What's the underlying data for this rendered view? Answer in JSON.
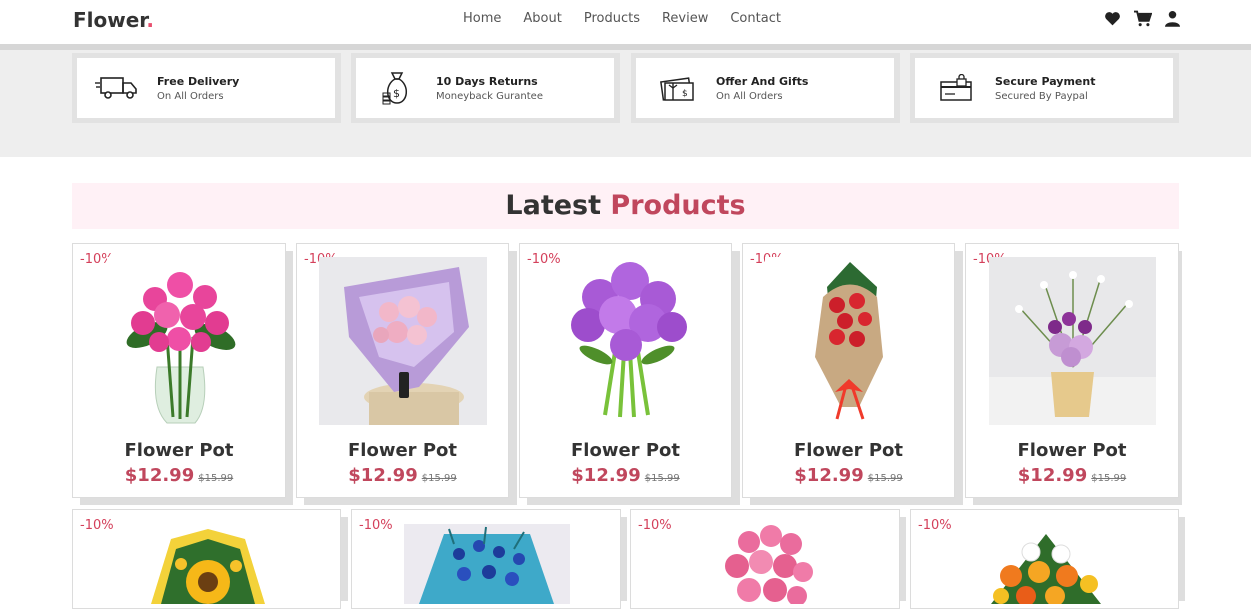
{
  "header": {
    "logo_text": "Flower",
    "logo_dot": ".",
    "nav": [
      "Home",
      "About",
      "Products",
      "Review",
      "Contact"
    ],
    "icons": [
      "heart-icon",
      "cart-icon",
      "user-icon"
    ]
  },
  "features": [
    {
      "icon": "truck-icon",
      "title": "Free Delivery",
      "subtitle": "On All Orders"
    },
    {
      "icon": "money-bag-icon",
      "title": "10 Days Returns",
      "subtitle": "Moneyback Gurantee"
    },
    {
      "icon": "gift-card-icon",
      "title": "Offer And Gifts",
      "subtitle": "On All Orders"
    },
    {
      "icon": "card-lock-icon",
      "title": "Secure Payment",
      "subtitle": "Secured By Paypal"
    }
  ],
  "section": {
    "title_main": "Latest",
    "title_accent": "Products"
  },
  "products_row1": [
    {
      "discount": "-10%",
      "name": "Flower Pot",
      "price": "$12.99",
      "old_price": "$15.99"
    },
    {
      "discount": "-10%",
      "name": "Flower Pot",
      "price": "$12.99",
      "old_price": "$15.99"
    },
    {
      "discount": "-10%",
      "name": "Flower Pot",
      "price": "$12.99",
      "old_price": "$15.99"
    },
    {
      "discount": "-10%",
      "name": "Flower Pot",
      "price": "$12.99",
      "old_price": "$15.99"
    },
    {
      "discount": "-10%",
      "name": "Flower Pot",
      "price": "$12.99",
      "old_price": "$15.99"
    }
  ],
  "products_row2": [
    {
      "discount": "-10%"
    },
    {
      "discount": "-10%"
    },
    {
      "discount": "-10%"
    },
    {
      "discount": "-10%"
    }
  ],
  "colors": {
    "accent": "#c0475d",
    "discount": "#d4405b",
    "heading_bg": "#fff1f6"
  }
}
